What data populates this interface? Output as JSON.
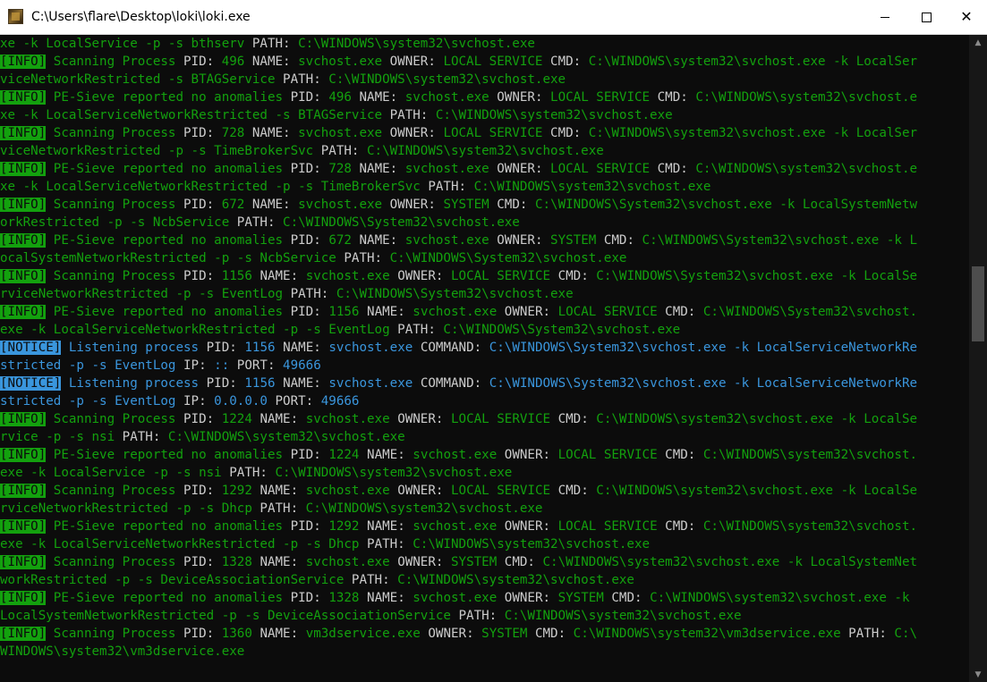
{
  "window": {
    "title": "C:\\Users\\flare\\Desktop\\loki\\loki.exe",
    "min_symbol": "—",
    "max_symbol": "☐",
    "close_symbol": "✕"
  },
  "colors": {
    "info": "#13a10e",
    "notice": "#3a96dd",
    "label": "#cccccc",
    "background": "#0c0c0c"
  },
  "console": {
    "lines": [
      [
        [
          "g",
          "xe -k LocalService -p -s bthserv "
        ],
        [
          "w",
          "PATH: "
        ],
        [
          "g",
          "C:\\WINDOWS\\system32\\svchost.exe"
        ]
      ],
      [
        [
          "ti",
          "[INFO]"
        ],
        [
          "g",
          " Scanning Process "
        ],
        [
          "w",
          "PID: "
        ],
        [
          "g",
          "496 "
        ],
        [
          "w",
          "NAME: "
        ],
        [
          "g",
          "svchost.exe "
        ],
        [
          "w",
          "OWNER: "
        ],
        [
          "g",
          "LOCAL SERVICE "
        ],
        [
          "w",
          "CMD: "
        ],
        [
          "g",
          "C:\\WINDOWS\\system32\\svchost.exe -k LocalSer"
        ]
      ],
      [
        [
          "g",
          "viceNetworkRestricted -s BTAGService "
        ],
        [
          "w",
          "PATH: "
        ],
        [
          "g",
          "C:\\WINDOWS\\system32\\svchost.exe"
        ]
      ],
      [
        [
          "ti",
          "[INFO]"
        ],
        [
          "g",
          " PE-Sieve reported no anomalies "
        ],
        [
          "w",
          "PID: "
        ],
        [
          "g",
          "496 "
        ],
        [
          "w",
          "NAME: "
        ],
        [
          "g",
          "svchost.exe "
        ],
        [
          "w",
          "OWNER: "
        ],
        [
          "g",
          "LOCAL SERVICE "
        ],
        [
          "w",
          "CMD: "
        ],
        [
          "g",
          "C:\\WINDOWS\\system32\\svchost.e"
        ]
      ],
      [
        [
          "g",
          "xe -k LocalServiceNetworkRestricted -s BTAGService "
        ],
        [
          "w",
          "PATH: "
        ],
        [
          "g",
          "C:\\WINDOWS\\system32\\svchost.exe"
        ]
      ],
      [
        [
          "ti",
          "[INFO]"
        ],
        [
          "g",
          " Scanning Process "
        ],
        [
          "w",
          "PID: "
        ],
        [
          "g",
          "728 "
        ],
        [
          "w",
          "NAME: "
        ],
        [
          "g",
          "svchost.exe "
        ],
        [
          "w",
          "OWNER: "
        ],
        [
          "g",
          "LOCAL SERVICE "
        ],
        [
          "w",
          "CMD: "
        ],
        [
          "g",
          "C:\\WINDOWS\\system32\\svchost.exe -k LocalSer"
        ]
      ],
      [
        [
          "g",
          "viceNetworkRestricted -p -s TimeBrokerSvc "
        ],
        [
          "w",
          "PATH: "
        ],
        [
          "g",
          "C:\\WINDOWS\\system32\\svchost.exe"
        ]
      ],
      [
        [
          "ti",
          "[INFO]"
        ],
        [
          "g",
          " PE-Sieve reported no anomalies "
        ],
        [
          "w",
          "PID: "
        ],
        [
          "g",
          "728 "
        ],
        [
          "w",
          "NAME: "
        ],
        [
          "g",
          "svchost.exe "
        ],
        [
          "w",
          "OWNER: "
        ],
        [
          "g",
          "LOCAL SERVICE "
        ],
        [
          "w",
          "CMD: "
        ],
        [
          "g",
          "C:\\WINDOWS\\system32\\svchost.e"
        ]
      ],
      [
        [
          "g",
          "xe -k LocalServiceNetworkRestricted -p -s TimeBrokerSvc "
        ],
        [
          "w",
          "PATH: "
        ],
        [
          "g",
          "C:\\WINDOWS\\system32\\svchost.exe"
        ]
      ],
      [
        [
          "ti",
          "[INFO]"
        ],
        [
          "g",
          " Scanning Process "
        ],
        [
          "w",
          "PID: "
        ],
        [
          "g",
          "672 "
        ],
        [
          "w",
          "NAME: "
        ],
        [
          "g",
          "svchost.exe "
        ],
        [
          "w",
          "OWNER: "
        ],
        [
          "g",
          "SYSTEM "
        ],
        [
          "w",
          "CMD: "
        ],
        [
          "g",
          "C:\\WINDOWS\\System32\\svchost.exe -k LocalSystemNetw"
        ]
      ],
      [
        [
          "g",
          "orkRestricted -p -s NcbService "
        ],
        [
          "w",
          "PATH: "
        ],
        [
          "g",
          "C:\\WINDOWS\\System32\\svchost.exe"
        ]
      ],
      [
        [
          "ti",
          "[INFO]"
        ],
        [
          "g",
          " PE-Sieve reported no anomalies "
        ],
        [
          "w",
          "PID: "
        ],
        [
          "g",
          "672 "
        ],
        [
          "w",
          "NAME: "
        ],
        [
          "g",
          "svchost.exe "
        ],
        [
          "w",
          "OWNER: "
        ],
        [
          "g",
          "SYSTEM "
        ],
        [
          "w",
          "CMD: "
        ],
        [
          "g",
          "C:\\WINDOWS\\System32\\svchost.exe -k L"
        ]
      ],
      [
        [
          "g",
          "ocalSystemNetworkRestricted -p -s NcbService "
        ],
        [
          "w",
          "PATH: "
        ],
        [
          "g",
          "C:\\WINDOWS\\System32\\svchost.exe"
        ]
      ],
      [
        [
          "ti",
          "[INFO]"
        ],
        [
          "g",
          " Scanning Process "
        ],
        [
          "w",
          "PID: "
        ],
        [
          "g",
          "1156 "
        ],
        [
          "w",
          "NAME: "
        ],
        [
          "g",
          "svchost.exe "
        ],
        [
          "w",
          "OWNER: "
        ],
        [
          "g",
          "LOCAL SERVICE "
        ],
        [
          "w",
          "CMD: "
        ],
        [
          "g",
          "C:\\WINDOWS\\System32\\svchost.exe -k LocalSe"
        ]
      ],
      [
        [
          "g",
          "rviceNetworkRestricted -p -s EventLog "
        ],
        [
          "w",
          "PATH: "
        ],
        [
          "g",
          "C:\\WINDOWS\\System32\\svchost.exe"
        ]
      ],
      [
        [
          "ti",
          "[INFO]"
        ],
        [
          "g",
          " PE-Sieve reported no anomalies "
        ],
        [
          "w",
          "PID: "
        ],
        [
          "g",
          "1156 "
        ],
        [
          "w",
          "NAME: "
        ],
        [
          "g",
          "svchost.exe "
        ],
        [
          "w",
          "OWNER: "
        ],
        [
          "g",
          "LOCAL SERVICE "
        ],
        [
          "w",
          "CMD: "
        ],
        [
          "g",
          "C:\\WINDOWS\\System32\\svchost."
        ]
      ],
      [
        [
          "g",
          "exe -k LocalServiceNetworkRestricted -p -s EventLog "
        ],
        [
          "w",
          "PATH: "
        ],
        [
          "g",
          "C:\\WINDOWS\\System32\\svchost.exe"
        ]
      ],
      [
        [
          "tn",
          "[NOTICE]"
        ],
        [
          "c",
          " Listening process "
        ],
        [
          "w",
          "PID: "
        ],
        [
          "c",
          "1156 "
        ],
        [
          "w",
          "NAME: "
        ],
        [
          "c",
          "svchost.exe "
        ],
        [
          "w",
          "COMMAND: "
        ],
        [
          "c",
          "C:\\WINDOWS\\System32\\svchost.exe -k LocalServiceNetworkRe"
        ]
      ],
      [
        [
          "c",
          "stricted -p -s EventLog "
        ],
        [
          "w",
          "IP: "
        ],
        [
          "c",
          ":: "
        ],
        [
          "w",
          "PORT: "
        ],
        [
          "c",
          "49666"
        ]
      ],
      [
        [
          "tn",
          "[NOTICE]"
        ],
        [
          "c",
          " Listening process "
        ],
        [
          "w",
          "PID: "
        ],
        [
          "c",
          "1156 "
        ],
        [
          "w",
          "NAME: "
        ],
        [
          "c",
          "svchost.exe "
        ],
        [
          "w",
          "COMMAND: "
        ],
        [
          "c",
          "C:\\WINDOWS\\System32\\svchost.exe -k LocalServiceNetworkRe"
        ]
      ],
      [
        [
          "c",
          "stricted -p -s EventLog "
        ],
        [
          "w",
          "IP: "
        ],
        [
          "c",
          "0.0.0.0 "
        ],
        [
          "w",
          "PORT: "
        ],
        [
          "c",
          "49666"
        ]
      ],
      [
        [
          "ti",
          "[INFO]"
        ],
        [
          "g",
          " Scanning Process "
        ],
        [
          "w",
          "PID: "
        ],
        [
          "g",
          "1224 "
        ],
        [
          "w",
          "NAME: "
        ],
        [
          "g",
          "svchost.exe "
        ],
        [
          "w",
          "OWNER: "
        ],
        [
          "g",
          "LOCAL SERVICE "
        ],
        [
          "w",
          "CMD: "
        ],
        [
          "g",
          "C:\\WINDOWS\\system32\\svchost.exe -k LocalSe"
        ]
      ],
      [
        [
          "g",
          "rvice -p -s nsi "
        ],
        [
          "w",
          "PATH: "
        ],
        [
          "g",
          "C:\\WINDOWS\\system32\\svchost.exe"
        ]
      ],
      [
        [
          "ti",
          "[INFO]"
        ],
        [
          "g",
          " PE-Sieve reported no anomalies "
        ],
        [
          "w",
          "PID: "
        ],
        [
          "g",
          "1224 "
        ],
        [
          "w",
          "NAME: "
        ],
        [
          "g",
          "svchost.exe "
        ],
        [
          "w",
          "OWNER: "
        ],
        [
          "g",
          "LOCAL SERVICE "
        ],
        [
          "w",
          "CMD: "
        ],
        [
          "g",
          "C:\\WINDOWS\\system32\\svchost."
        ]
      ],
      [
        [
          "g",
          "exe -k LocalService -p -s nsi "
        ],
        [
          "w",
          "PATH: "
        ],
        [
          "g",
          "C:\\WINDOWS\\system32\\svchost.exe"
        ]
      ],
      [
        [
          "ti",
          "[INFO]"
        ],
        [
          "g",
          " Scanning Process "
        ],
        [
          "w",
          "PID: "
        ],
        [
          "g",
          "1292 "
        ],
        [
          "w",
          "NAME: "
        ],
        [
          "g",
          "svchost.exe "
        ],
        [
          "w",
          "OWNER: "
        ],
        [
          "g",
          "LOCAL SERVICE "
        ],
        [
          "w",
          "CMD: "
        ],
        [
          "g",
          "C:\\WINDOWS\\system32\\svchost.exe -k LocalSe"
        ]
      ],
      [
        [
          "g",
          "rviceNetworkRestricted -p -s Dhcp "
        ],
        [
          "w",
          "PATH: "
        ],
        [
          "g",
          "C:\\WINDOWS\\system32\\svchost.exe"
        ]
      ],
      [
        [
          "ti",
          "[INFO]"
        ],
        [
          "g",
          " PE-Sieve reported no anomalies "
        ],
        [
          "w",
          "PID: "
        ],
        [
          "g",
          "1292 "
        ],
        [
          "w",
          "NAME: "
        ],
        [
          "g",
          "svchost.exe "
        ],
        [
          "w",
          "OWNER: "
        ],
        [
          "g",
          "LOCAL SERVICE "
        ],
        [
          "w",
          "CMD: "
        ],
        [
          "g",
          "C:\\WINDOWS\\system32\\svchost."
        ]
      ],
      [
        [
          "g",
          "exe -k LocalServiceNetworkRestricted -p -s Dhcp "
        ],
        [
          "w",
          "PATH: "
        ],
        [
          "g",
          "C:\\WINDOWS\\system32\\svchost.exe"
        ]
      ],
      [
        [
          "ti",
          "[INFO]"
        ],
        [
          "g",
          " Scanning Process "
        ],
        [
          "w",
          "PID: "
        ],
        [
          "g",
          "1328 "
        ],
        [
          "w",
          "NAME: "
        ],
        [
          "g",
          "svchost.exe "
        ],
        [
          "w",
          "OWNER: "
        ],
        [
          "g",
          "SYSTEM "
        ],
        [
          "w",
          "CMD: "
        ],
        [
          "g",
          "C:\\WINDOWS\\system32\\svchost.exe -k LocalSystemNet"
        ]
      ],
      [
        [
          "g",
          "workRestricted -p -s DeviceAssociationService "
        ],
        [
          "w",
          "PATH: "
        ],
        [
          "g",
          "C:\\WINDOWS\\system32\\svchost.exe"
        ]
      ],
      [
        [
          "ti",
          "[INFO]"
        ],
        [
          "g",
          " PE-Sieve reported no anomalies "
        ],
        [
          "w",
          "PID: "
        ],
        [
          "g",
          "1328 "
        ],
        [
          "w",
          "NAME: "
        ],
        [
          "g",
          "svchost.exe "
        ],
        [
          "w",
          "OWNER: "
        ],
        [
          "g",
          "SYSTEM "
        ],
        [
          "w",
          "CMD: "
        ],
        [
          "g",
          "C:\\WINDOWS\\system32\\svchost.exe -k"
        ]
      ],
      [
        [
          "g",
          "LocalSystemNetworkRestricted -p -s DeviceAssociationService "
        ],
        [
          "w",
          "PATH: "
        ],
        [
          "g",
          "C:\\WINDOWS\\system32\\svchost.exe"
        ]
      ],
      [
        [
          "ti",
          "[INFO]"
        ],
        [
          "g",
          " Scanning Process "
        ],
        [
          "w",
          "PID: "
        ],
        [
          "g",
          "1360 "
        ],
        [
          "w",
          "NAME: "
        ],
        [
          "g",
          "vm3dservice.exe "
        ],
        [
          "w",
          "OWNER: "
        ],
        [
          "g",
          "SYSTEM "
        ],
        [
          "w",
          "CMD: "
        ],
        [
          "g",
          "C:\\WINDOWS\\system32\\vm3dservice.exe "
        ],
        [
          "w",
          "PATH: "
        ],
        [
          "g",
          "C:\\"
        ]
      ],
      [
        [
          "g",
          "WINDOWS\\system32\\vm3dservice.exe"
        ]
      ]
    ]
  },
  "scrollbar": {
    "up_arrow": "▲",
    "down_arrow": "▼",
    "position_fraction": 0.4
  }
}
